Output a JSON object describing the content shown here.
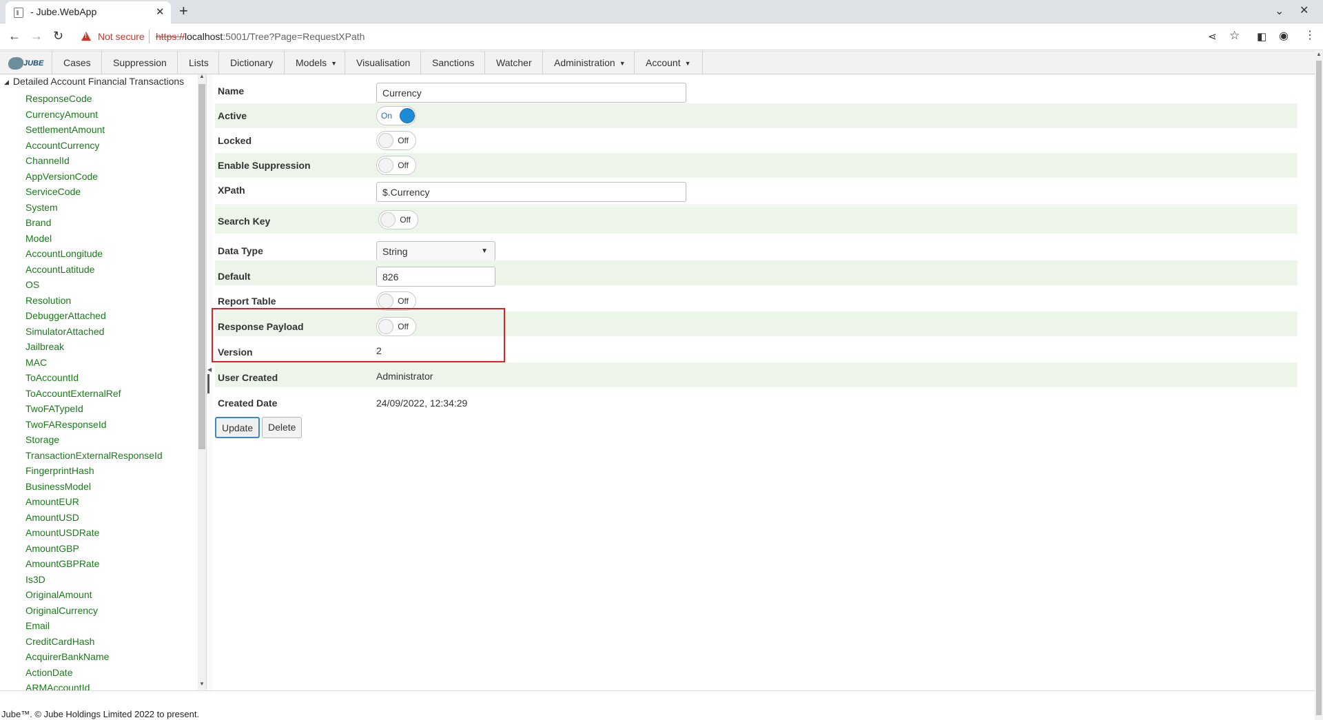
{
  "browser": {
    "tab_title": "- Jube.WebApp",
    "tab_close": "✕",
    "new_tab": "+",
    "url_not_secure": "Not secure",
    "url_scheme": "https://",
    "url_host": "localhost",
    "url_path": ":5001/Tree?Page=RequestXPath"
  },
  "nav": {
    "logo_text": "JUBE",
    "items": [
      "Cases",
      "Suppression",
      "Lists",
      "Dictionary",
      "Models",
      "Visualisation",
      "Sanctions",
      "Watcher",
      "Administration",
      "Account"
    ]
  },
  "tree": {
    "root": "Detailed Account Financial Transactions",
    "items": [
      "ResponseCode",
      "CurrencyAmount",
      "SettlementAmount",
      "AccountCurrency",
      "ChannelId",
      "AppVersionCode",
      "ServiceCode",
      "System",
      "Brand",
      "Model",
      "AccountLongitude",
      "AccountLatitude",
      "OS",
      "Resolution",
      "DebuggerAttached",
      "SimulatorAttached",
      "Jailbreak",
      "MAC",
      "ToAccountId",
      "ToAccountExternalRef",
      "TwoFATypeId",
      "TwoFAResponseId",
      "Storage",
      "TransactionExternalResponseId",
      "FingerprintHash",
      "BusinessModel",
      "AmountEUR",
      "AmountUSD",
      "AmountUSDRate",
      "AmountGBP",
      "AmountGBPRate",
      "Is3D",
      "OriginalAmount",
      "OriginalCurrency",
      "Email",
      "CreditCardHash",
      "AcquirerBankName",
      "ActionDate",
      "ARMAccountId"
    ]
  },
  "form": {
    "name_label": "Name",
    "name_value": "Currency",
    "active_label": "Active",
    "active_state": "On",
    "locked_label": "Locked",
    "locked_state": "Off",
    "suppression_label": "Enable Suppression",
    "suppression_state": "Off",
    "xpath_label": "XPath",
    "xpath_value": "$.Currency",
    "search_key_label": "Search Key",
    "search_key_state": "Off",
    "data_type_label": "Data Type",
    "data_type_value": "String",
    "default_label": "Default",
    "default_value": "826",
    "report_table_label": "Report Table",
    "report_table_state": "Off",
    "response_payload_label": "Response Payload",
    "response_payload_state": "Off",
    "version_label": "Version",
    "version_value": "2",
    "user_created_label": "User Created",
    "user_created_value": "Administrator",
    "created_date_label": "Created Date",
    "created_date_value": "24/09/2022, 12:34:29",
    "update_button": "Update",
    "delete_button": "Delete"
  },
  "footer": {
    "text": "Jube™. © Jube Holdings Limited 2022 to present."
  },
  "colors": {
    "tree_link": "#1a7a1a",
    "row_alt": "#edf5eb",
    "toggle_on": "#1f8ad6",
    "highlight": "#e02020"
  }
}
